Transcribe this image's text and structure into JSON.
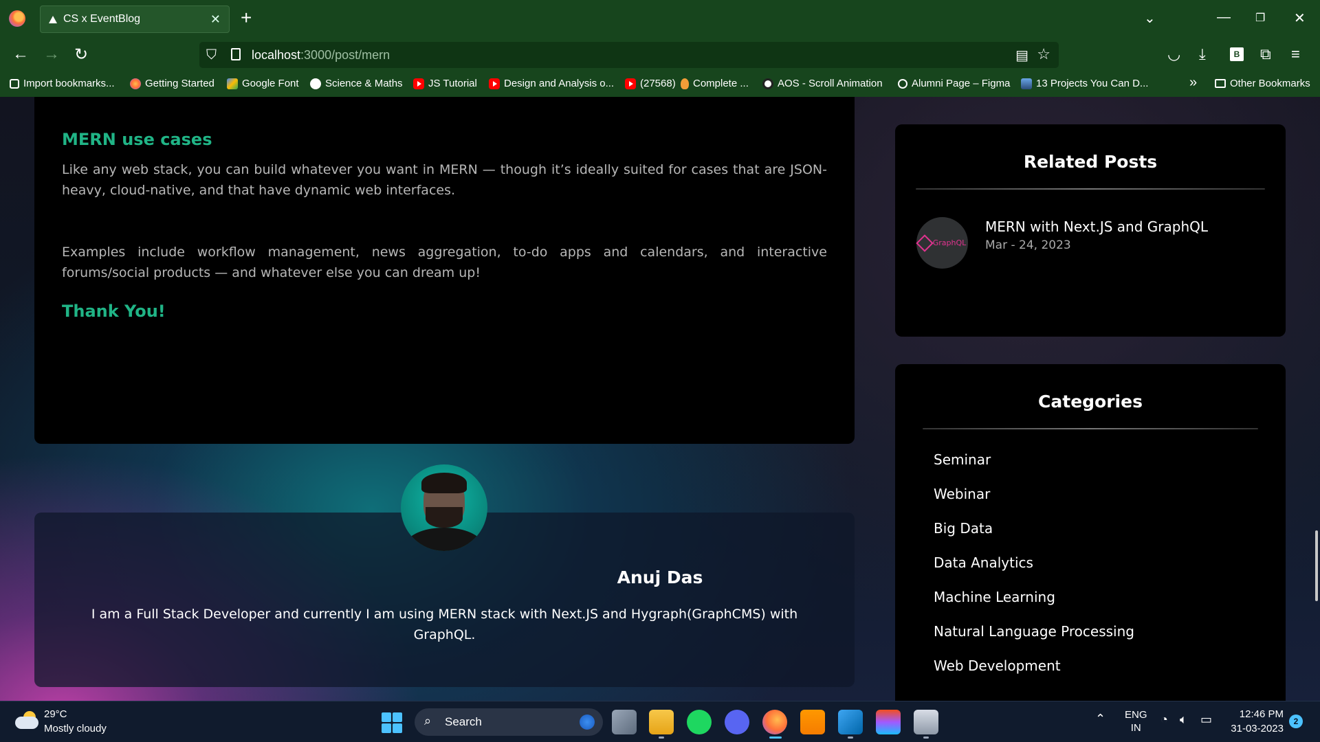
{
  "browser": {
    "tab_title": "CS x EventBlog",
    "url_host": "localhost",
    "url_rest": ":3000/post/mern",
    "bookmarks": [
      "Import bookmarks...",
      "Getting Started",
      "Google Font",
      "Science & Maths",
      "JS Tutorial",
      "Design and Analysis o...",
      "(27568)",
      "Complete ...",
      "AOS - Scroll Animation",
      "Alumni Page – Figma",
      "13 Projects You Can D...",
      "Other Bookmarks"
    ]
  },
  "article": {
    "heading": "MERN use cases",
    "paragraph1": "Like any web stack, you can build whatever you want in MERN — though it’s ideally suited for cases that are JSON-heavy, cloud-native, and that have dynamic web interfaces.",
    "paragraph2": "Examples include workflow management, news aggregation, to-do apps and calendars, and interactive forums/social products — and whatever else you can dream up!",
    "closing": "Thank You!"
  },
  "author": {
    "name": "Anuj Das",
    "bio": "I am a Full Stack Developer and currently I am using MERN stack with Next.JS and Hygraph(GraphCMS) with GraphQL."
  },
  "related": {
    "title": "Related Posts",
    "posts": [
      {
        "title": "MERN with Next.JS and GraphQL",
        "date": "Mar - 24, 2023",
        "thumb_text": "GraphQL"
      }
    ]
  },
  "categories": {
    "title": "Categories",
    "items": [
      "Seminar",
      "Webinar",
      "Big Data",
      "Data Analytics",
      "Machine Learning",
      "Natural Language Processing",
      "Web Development"
    ]
  },
  "taskbar": {
    "temperature": "29°C",
    "weather": "Mostly cloudy",
    "search_label": "Search",
    "lang_line1": "ENG",
    "lang_line2": "IN",
    "time": "12:46 PM",
    "date": "31-03-2023",
    "notifications": "2"
  },
  "colors": {
    "accent_green": "#20b486",
    "chrome_green": "#17451d"
  }
}
